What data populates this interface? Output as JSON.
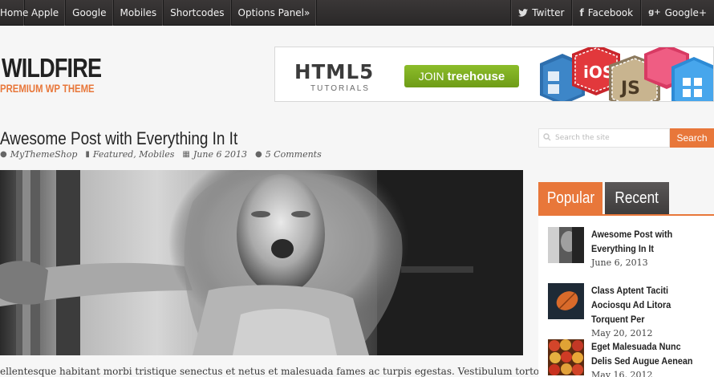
{
  "nav": {
    "items": [
      "Home",
      "Apple",
      "Google",
      "Mobiles",
      "Shortcodes",
      "Options Panel»"
    ]
  },
  "social": {
    "twitter": "Twitter",
    "facebook": "Facebook",
    "google": "Google+"
  },
  "logo": {
    "title": "WILDFIRE",
    "subtitle": "PREMIUM WP THEME"
  },
  "banner": {
    "html5": "HTML5",
    "tutorials": "TUTORIALS",
    "join": "JOIN",
    "brand": "treehouse",
    "badges": [
      "iOS",
      "JS"
    ]
  },
  "post": {
    "title": "Awesome Post with Everything In It",
    "author": "MyThemeShop",
    "categories": "Featured, Mobiles",
    "date": "June 6 2013",
    "comments": "5 Comments",
    "excerpt": "ellentesque habitant morbi tristique senectus et netus et malesuada fames ac turpis egestas. Vestibulum tortor quam, feugiat"
  },
  "sidebar": {
    "search_placeholder": "Search the site",
    "search_button": "Search",
    "tabs": {
      "popular": "Popular",
      "recent": "Recent"
    },
    "items": [
      {
        "title": "Awesome Post with Everything In It",
        "date": "June 6, 2013"
      },
      {
        "title": "Class Aptent Taciti Aociosqu Ad Litora Torquent Per",
        "date": "May 20, 2012"
      },
      {
        "title": "Eget Malesuada Nunc Delis Sed Augue Aenean",
        "date": "May 16, 2012"
      }
    ]
  },
  "colors": {
    "accent": "#e8773a",
    "topbar": "#2f2d2d",
    "treehouse_green": "#7aab1e"
  }
}
